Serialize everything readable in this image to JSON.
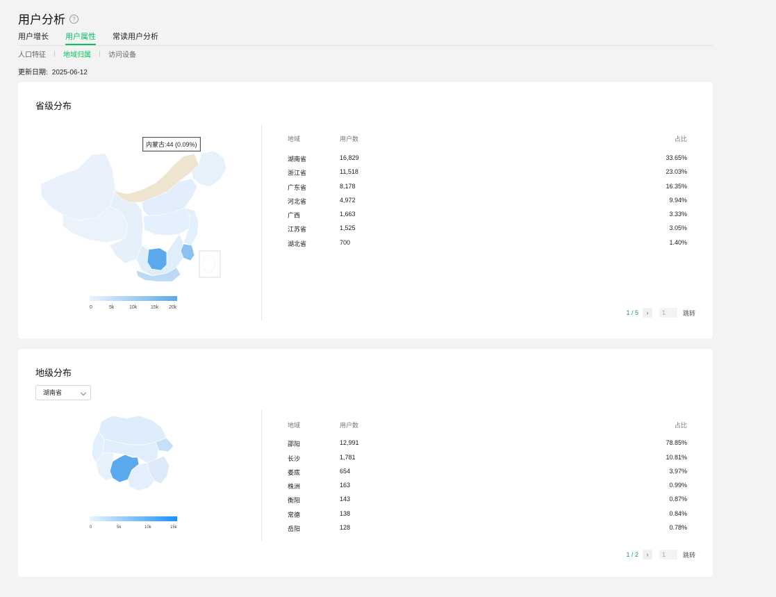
{
  "header": {
    "title": "用户分析",
    "help": "?"
  },
  "tabs": [
    {
      "label": "用户增长",
      "active": false
    },
    {
      "label": "用户属性",
      "active": true
    },
    {
      "label": "常读用户分析",
      "active": false
    }
  ],
  "subtabs": [
    {
      "label": "人口特征",
      "active": false
    },
    {
      "label": "地域归属",
      "active": true
    },
    {
      "label": "访问设备",
      "active": false
    }
  ],
  "update": {
    "label": "更新日期:",
    "date": "2025-06-12"
  },
  "province": {
    "title": "省级分布",
    "tooltip": "内蒙古:44 (0.09%)",
    "legend": [
      "0",
      "5k",
      "10k",
      "15k",
      "20k"
    ],
    "columns": [
      "地域",
      "用户数",
      "占比"
    ],
    "rows": [
      [
        "湖南省",
        "16,829",
        "33.65%"
      ],
      [
        "浙江省",
        "11,518",
        "23.03%"
      ],
      [
        "广东省",
        "8,178",
        "16.35%"
      ],
      [
        "河北省",
        "4,972",
        "9.94%"
      ],
      [
        "广西",
        "1,663",
        "3.33%"
      ],
      [
        "江苏省",
        "1,525",
        "3.05%"
      ],
      [
        "湖北省",
        "700",
        "1.40%"
      ]
    ],
    "pager": {
      "text": "1 / 5",
      "next": "›",
      "input": "1",
      "jump": "跳转"
    }
  },
  "city": {
    "title": "地级分布",
    "select": "湖南省",
    "legend": [
      "0",
      "5k",
      "10k",
      "15k"
    ],
    "columns": [
      "地域",
      "用户数",
      "占比"
    ],
    "rows": [
      [
        "邵阳",
        "12,991",
        "78.85%"
      ],
      [
        "长沙",
        "1,781",
        "10.81%"
      ],
      [
        "娄底",
        "654",
        "3.97%"
      ],
      [
        "株洲",
        "163",
        "0.99%"
      ],
      [
        "衡阳",
        "143",
        "0.87%"
      ],
      [
        "常德",
        "138",
        "0.84%"
      ],
      [
        "岳阳",
        "128",
        "0.78%"
      ]
    ],
    "pager": {
      "text": "1 / 2",
      "next": "›",
      "input": "1",
      "jump": "跳转"
    }
  },
  "colors": {
    "accent": "#07c160",
    "map_low": "#e6f1fc",
    "map_high": "#1890ff",
    "map_highlight": "#efe4cf"
  }
}
